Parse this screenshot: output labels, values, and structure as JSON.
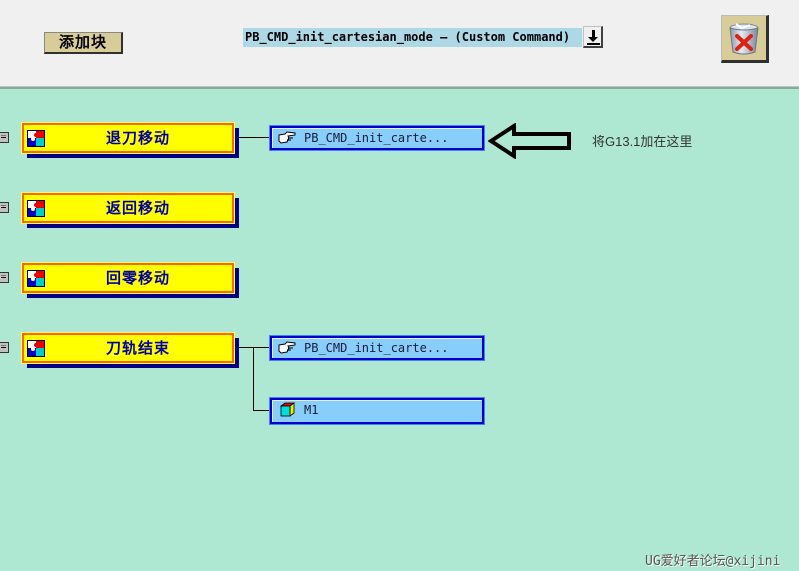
{
  "header": {
    "add_block_label": "添加块",
    "selected_command": "PB_CMD_init_cartesian_mode — (Custom Command)",
    "dropdown_icon": "arrow-down-to-line-icon",
    "trash_icon": "trash-delete-icon"
  },
  "tree": {
    "groups": [
      {
        "label": "退刀移动",
        "icon": "puzzle-icon",
        "children": [
          {
            "label": "PB_CMD_init_carte...",
            "icon": "pointing-hand-icon"
          }
        ]
      },
      {
        "label": "返回移动",
        "icon": "puzzle-icon",
        "children": []
      },
      {
        "label": "回零移动",
        "icon": "puzzle-icon",
        "children": []
      },
      {
        "label": "刀轨结束",
        "icon": "puzzle-icon",
        "children": [
          {
            "label": "PB_CMD_init_carte...",
            "icon": "pointing-hand-icon"
          },
          {
            "label": "M1",
            "icon": "cube-icon"
          }
        ]
      }
    ]
  },
  "annotation": {
    "text": "将G13.1加在这里",
    "arrow_icon": "arrow-left-icon"
  },
  "watermark": "UG爱好者论坛@xijini"
}
